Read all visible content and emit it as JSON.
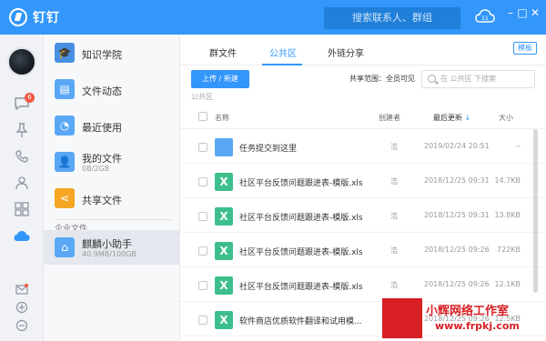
{
  "app": {
    "title": "钉钉",
    "search_placeholder": "搜索联系人、群组"
  },
  "rail": {
    "badge_count": "6"
  },
  "nav": {
    "items": [
      {
        "label": "知识学院",
        "sub": ""
      },
      {
        "label": "文件动态",
        "sub": ""
      },
      {
        "label": "最近使用",
        "sub": ""
      },
      {
        "label": "我的文件",
        "sub": "0B/2GB"
      },
      {
        "label": "共享文件",
        "sub": ""
      }
    ],
    "section_label": "企业文件",
    "enterprise": {
      "label": "麒麟小助手",
      "sub": "40.9MB/100GB"
    }
  },
  "main": {
    "tabs": [
      "群文件",
      "公共区",
      "外链分享"
    ],
    "active_tab": "公共区",
    "mode_button": "模板",
    "upload_button": "上传 / 新建",
    "scope_label": "共享范围：",
    "scope_value": "全员可见",
    "search_placeholder": "在 公共区 下搜索",
    "breadcrumb": "公共区",
    "columns": {
      "name": "名称",
      "creator": "创建者",
      "updated": "最后更新",
      "size": "大小"
    },
    "rows": [
      {
        "type": "folder",
        "name": "任务提交到这里",
        "creator": "浩",
        "date": "2019/02/24 20:51",
        "size": "--"
      },
      {
        "type": "xls",
        "name": "社区平台反馈问题跟进表-模版.xls",
        "creator": "浩",
        "date": "2018/12/25 09:31",
        "size": "14.7KB"
      },
      {
        "type": "xls",
        "name": "社区平台反馈问题跟进表-模版.xls",
        "creator": "浩",
        "date": "2018/12/25 09:31",
        "size": "13.8KB"
      },
      {
        "type": "xls",
        "name": "社区平台反馈问题跟进表-模版.xls",
        "creator": "浩",
        "date": "2018/12/25 09:26",
        "size": "722KB"
      },
      {
        "type": "xls",
        "name": "社区平台反馈问题跟进表-模版.xls",
        "creator": "浩",
        "date": "2018/12/25 09:26",
        "size": "12.1KB"
      },
      {
        "type": "xls",
        "name": "软件商店优质软件翻译和试用模...",
        "creator": "浩",
        "date": "2018/12/25 09:26",
        "size": "12.5KB"
      }
    ]
  },
  "watermark": {
    "logo": "小辉\n网络",
    "line1": "小辉网络工作室",
    "line2": "www.frpkj.com"
  },
  "colors": {
    "accent": "#3296fa",
    "xls": "#3dbf8c",
    "folder": "#5aa8f5",
    "badge": "#f25643"
  }
}
